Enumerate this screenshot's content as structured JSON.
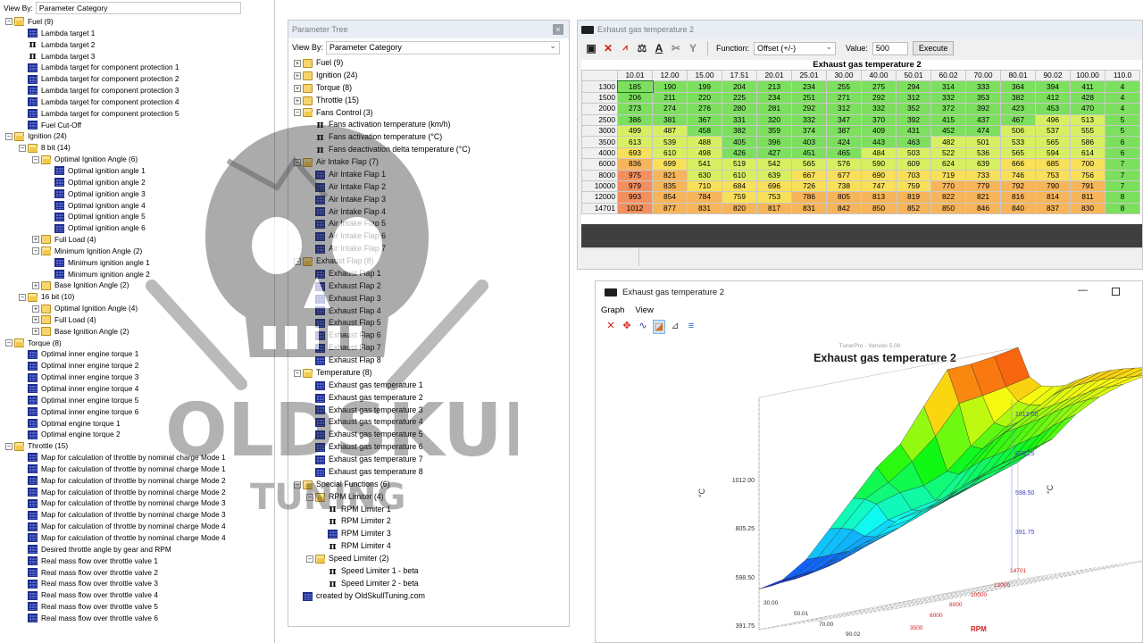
{
  "left_tree": {
    "view_by_label": "View By:",
    "view_by_value": "Parameter Category",
    "items": [
      {
        "d": 0,
        "exp": "−",
        "icon": "folder-open",
        "label": "Fuel (9)"
      },
      {
        "d": 1,
        "icon": "map",
        "label": "Lambda target 1"
      },
      {
        "d": 1,
        "icon": "pi",
        "label": "Lambda target 2"
      },
      {
        "d": 1,
        "icon": "pi",
        "label": "Lambda target 3"
      },
      {
        "d": 1,
        "icon": "map",
        "label": "Lambda target for component protection 1"
      },
      {
        "d": 1,
        "icon": "map",
        "label": "Lambda target for component protection 2"
      },
      {
        "d": 1,
        "icon": "map",
        "label": "Lambda target for component protection 3"
      },
      {
        "d": 1,
        "icon": "map",
        "label": "Lambda target for component protection 4"
      },
      {
        "d": 1,
        "icon": "map",
        "label": "Lambda target for component protection 5"
      },
      {
        "d": 1,
        "icon": "map",
        "label": "Fuel Cut-Off"
      },
      {
        "d": 0,
        "exp": "−",
        "icon": "folder-open",
        "label": "Ignition (24)"
      },
      {
        "d": 1,
        "exp": "−",
        "icon": "folder-open",
        "label": "8 bit (14)"
      },
      {
        "d": 2,
        "exp": "−",
        "icon": "folder-open",
        "label": "Optimal Ignition Angle (6)"
      },
      {
        "d": 3,
        "icon": "map",
        "label": "Optimal ignition angle 1"
      },
      {
        "d": 3,
        "icon": "map",
        "label": "Optimal ignition angle 2"
      },
      {
        "d": 3,
        "icon": "map",
        "label": "Optimal ignition angle 3"
      },
      {
        "d": 3,
        "icon": "map",
        "label": "Optimal ignition angle 4"
      },
      {
        "d": 3,
        "icon": "map",
        "label": "Optimal ignition angle 5"
      },
      {
        "d": 3,
        "icon": "map",
        "label": "Optimal ignition angle 6"
      },
      {
        "d": 2,
        "exp": "+",
        "icon": "folder",
        "label": "Full Load (4)"
      },
      {
        "d": 2,
        "exp": "−",
        "icon": "folder-open",
        "label": "Minimum Ignition Angle (2)"
      },
      {
        "d": 3,
        "icon": "map",
        "label": "Minimum ignition angle 1"
      },
      {
        "d": 3,
        "icon": "map",
        "label": "Minimum ignition angle 2"
      },
      {
        "d": 2,
        "exp": "+",
        "icon": "folder",
        "label": "Base Ignition Angle (2)"
      },
      {
        "d": 1,
        "exp": "−",
        "icon": "folder-open",
        "label": "16 bit (10)"
      },
      {
        "d": 2,
        "exp": "+",
        "icon": "folder",
        "label": "Optimal Ignition Angle (4)"
      },
      {
        "d": 2,
        "exp": "+",
        "icon": "folder",
        "label": "Full Load (4)"
      },
      {
        "d": 2,
        "exp": "+",
        "icon": "folder",
        "label": "Base Ignition Angle (2)"
      },
      {
        "d": 0,
        "exp": "−",
        "icon": "folder-open",
        "label": "Torque (8)"
      },
      {
        "d": 1,
        "icon": "map",
        "label": "Optimal inner engine torque 1"
      },
      {
        "d": 1,
        "icon": "map",
        "label": "Optimal inner engine torque 2"
      },
      {
        "d": 1,
        "icon": "map",
        "label": "Optimal inner engine torque 3"
      },
      {
        "d": 1,
        "icon": "map",
        "label": "Optimal inner engine torque 4"
      },
      {
        "d": 1,
        "icon": "map",
        "label": "Optimal inner engine torque 5"
      },
      {
        "d": 1,
        "icon": "map",
        "label": "Optimal inner engine torque 6"
      },
      {
        "d": 1,
        "icon": "map",
        "label": "Optimal engine torque 1"
      },
      {
        "d": 1,
        "icon": "map",
        "label": "Optimal engine torque 2"
      },
      {
        "d": 0,
        "exp": "−",
        "icon": "folder-open",
        "label": "Throttle (15)"
      },
      {
        "d": 1,
        "icon": "map",
        "label": "Map for calculation of throttle by nominal charge Mode 1"
      },
      {
        "d": 1,
        "icon": "map",
        "label": "Map for calculation of throttle by nominal charge Mode 1"
      },
      {
        "d": 1,
        "icon": "map",
        "label": "Map for calculation of throttle by nominal charge Mode 2"
      },
      {
        "d": 1,
        "icon": "map",
        "label": "Map for calculation of throttle by nominal charge Mode 2"
      },
      {
        "d": 1,
        "icon": "map",
        "label": "Map for calculation of throttle by nominal charge Mode 3"
      },
      {
        "d": 1,
        "icon": "map",
        "label": "Map for calculation of throttle by nominal charge Mode 3"
      },
      {
        "d": 1,
        "icon": "map",
        "label": "Map for calculation of throttle by nominal charge Mode 4"
      },
      {
        "d": 1,
        "icon": "map",
        "label": "Map for calculation of throttle by nominal charge Mode 4"
      },
      {
        "d": 1,
        "icon": "map",
        "label": "Desired throttle angle by gear and RPM"
      },
      {
        "d": 1,
        "icon": "map",
        "label": "Real mass flow over throttle valve 1"
      },
      {
        "d": 1,
        "icon": "map",
        "label": "Real mass flow over throttle valve 2"
      },
      {
        "d": 1,
        "icon": "map",
        "label": "Real mass flow over throttle valve 3"
      },
      {
        "d": 1,
        "icon": "map",
        "label": "Real mass flow over throttle valve 4"
      },
      {
        "d": 1,
        "icon": "map",
        "label": "Real mass flow over throttle valve 5"
      },
      {
        "d": 1,
        "icon": "map",
        "label": "Real mass flow over throttle valve 6"
      }
    ]
  },
  "mid_tree": {
    "title": "Parameter Tree",
    "close_glyph": "×",
    "view_by_label": "View By:",
    "view_by_value": "Parameter Category",
    "items": [
      {
        "d": 0,
        "exp": "+",
        "icon": "folder",
        "label": "Fuel (9)"
      },
      {
        "d": 0,
        "exp": "+",
        "icon": "folder",
        "label": "Ignition (24)"
      },
      {
        "d": 0,
        "exp": "+",
        "icon": "folder",
        "label": "Torque (8)"
      },
      {
        "d": 0,
        "exp": "+",
        "icon": "folder",
        "label": "Throttle (15)"
      },
      {
        "d": 0,
        "exp": "−",
        "icon": "folder-open",
        "label": "Fans Control (3)"
      },
      {
        "d": 1,
        "icon": "pi",
        "label": "Fans activation temperature (km/h)"
      },
      {
        "d": 1,
        "icon": "pi",
        "label": "Fans activation temperature (°C)"
      },
      {
        "d": 1,
        "icon": "pi",
        "label": "Fans deactivation delta temperature (°C)"
      },
      {
        "d": 0,
        "exp": "−",
        "icon": "folder-open",
        "label": "Air Intake Flap (7)"
      },
      {
        "d": 1,
        "icon": "map",
        "label": "Air Intake Flap 1"
      },
      {
        "d": 1,
        "icon": "map",
        "label": "Air Intake Flap 2"
      },
      {
        "d": 1,
        "icon": "map",
        "label": "Air Intake Flap 3"
      },
      {
        "d": 1,
        "icon": "map",
        "label": "Air Intake Flap 4"
      },
      {
        "d": 1,
        "icon": "map",
        "label": "Air Intake Flap 5"
      },
      {
        "d": 1,
        "icon": "map",
        "label": "Air Intake Flap 6"
      },
      {
        "d": 1,
        "icon": "map",
        "label": "Air Intake Flap 7"
      },
      {
        "d": 0,
        "exp": "−",
        "icon": "folder-open",
        "label": "Exhaust Flap (8)"
      },
      {
        "d": 1,
        "icon": "map",
        "label": "Exhaust Flap 1"
      },
      {
        "d": 1,
        "icon": "map",
        "label": "Exhaust Flap 2"
      },
      {
        "d": 1,
        "icon": "map",
        "label": "Exhaust Flap 3"
      },
      {
        "d": 1,
        "icon": "map",
        "label": "Exhaust Flap 4"
      },
      {
        "d": 1,
        "icon": "map",
        "label": "Exhaust Flap 5"
      },
      {
        "d": 1,
        "icon": "map",
        "label": "Exhaust Flap 6"
      },
      {
        "d": 1,
        "icon": "map",
        "label": "Exhaust Flap 7"
      },
      {
        "d": 1,
        "icon": "map",
        "label": "Exhaust Flap 8"
      },
      {
        "d": 0,
        "exp": "−",
        "icon": "folder-open",
        "label": "Temperature (8)"
      },
      {
        "d": 1,
        "icon": "map",
        "label": "Exhaust gas temperature 1"
      },
      {
        "d": 1,
        "icon": "map",
        "label": "Exhaust gas temperature 2"
      },
      {
        "d": 1,
        "icon": "map",
        "label": "Exhaust gas temperature 3"
      },
      {
        "d": 1,
        "icon": "map",
        "label": "Exhaust gas temperature 4"
      },
      {
        "d": 1,
        "icon": "map",
        "label": "Exhaust gas temperature 5"
      },
      {
        "d": 1,
        "icon": "map",
        "label": "Exhaust gas temperature 6"
      },
      {
        "d": 1,
        "icon": "map",
        "label": "Exhaust gas temperature 7"
      },
      {
        "d": 1,
        "icon": "map",
        "label": "Exhaust gas temperature 8"
      },
      {
        "d": 0,
        "exp": "−",
        "icon": "folder-open",
        "label": "Special Functions (6)"
      },
      {
        "d": 1,
        "exp": "−",
        "icon": "folder-open",
        "label": "RPM Limiter (4)"
      },
      {
        "d": 2,
        "icon": "pi",
        "label": "RPM Limiter 1"
      },
      {
        "d": 2,
        "icon": "pi",
        "label": "RPM Limiter 2"
      },
      {
        "d": 2,
        "icon": "map",
        "label": "RPM Limiter 3"
      },
      {
        "d": 2,
        "icon": "pi",
        "label": "RPM Limiter 4"
      },
      {
        "d": 1,
        "exp": "−",
        "icon": "folder-open",
        "label": "Speed Limiter (2)"
      },
      {
        "d": 2,
        "icon": "pi",
        "label": "Speed Limiter 1 - beta"
      },
      {
        "d": 2,
        "icon": "pi",
        "label": "Speed Limiter 2 - beta"
      },
      {
        "d": 0,
        "icon": "map",
        "label": "created by OldSkullTuning.com"
      }
    ]
  },
  "table_window": {
    "title": "Exhaust gas temperature 2",
    "toolbar_icons": [
      "save-icon",
      "delete-icon",
      "graph-icon",
      "balance-icon",
      "text-format-icon",
      "cut-icon",
      "merge-icon"
    ],
    "function_label": "Function:",
    "function_value": "Offset (+/-)",
    "value_label": "Value:",
    "value": "500",
    "execute_label": "Execute",
    "table_title": "Exhaust gas temperature 2",
    "columns": [
      "10.01",
      "12.00",
      "15.00",
      "17.51",
      "20.01",
      "25.01",
      "30.00",
      "40.00",
      "50.01",
      "60.02",
      "70.00",
      "80.01",
      "90.02",
      "100.00",
      "110.0"
    ],
    "rows": [
      {
        "rpm": "1300",
        "values": [
          "185",
          "190",
          "199",
          "204",
          "213",
          "234",
          "255",
          "275",
          "294",
          "314",
          "333",
          "364",
          "394",
          "411",
          "4"
        ]
      },
      {
        "rpm": "1500",
        "values": [
          "206",
          "211",
          "220",
          "225",
          "234",
          "251",
          "271",
          "292",
          "312",
          "332",
          "353",
          "382",
          "412",
          "428",
          "4"
        ]
      },
      {
        "rpm": "2000",
        "values": [
          "273",
          "274",
          "276",
          "280",
          "281",
          "292",
          "312",
          "332",
          "352",
          "372",
          "392",
          "423",
          "453",
          "470",
          "4"
        ]
      },
      {
        "rpm": "2500",
        "values": [
          "386",
          "381",
          "367",
          "331",
          "320",
          "332",
          "347",
          "370",
          "392",
          "415",
          "437",
          "467",
          "496",
          "513",
          "5"
        ]
      },
      {
        "rpm": "3000",
        "values": [
          "499",
          "487",
          "458",
          "382",
          "359",
          "374",
          "387",
          "409",
          "431",
          "452",
          "474",
          "506",
          "537",
          "555",
          "5"
        ]
      },
      {
        "rpm": "3500",
        "values": [
          "613",
          "539",
          "488",
          "405",
          "396",
          "403",
          "424",
          "443",
          "463",
          "482",
          "501",
          "533",
          "565",
          "586",
          "6"
        ]
      },
      {
        "rpm": "4000",
        "values": [
          "693",
          "610",
          "498",
          "426",
          "427",
          "451",
          "465",
          "484",
          "503",
          "522",
          "536",
          "565",
          "594",
          "614",
          "6"
        ]
      },
      {
        "rpm": "6000",
        "values": [
          "836",
          "699",
          "541",
          "519",
          "542",
          "565",
          "576",
          "590",
          "609",
          "624",
          "639",
          "666",
          "685",
          "700",
          "7"
        ]
      },
      {
        "rpm": "8000",
        "values": [
          "975",
          "821",
          "630",
          "610",
          "639",
          "667",
          "677",
          "690",
          "703",
          "719",
          "733",
          "746",
          "753",
          "756",
          "7"
        ]
      },
      {
        "rpm": "10000",
        "values": [
          "979",
          "835",
          "710",
          "684",
          "696",
          "726",
          "738",
          "747",
          "759",
          "770",
          "779",
          "792",
          "790",
          "791",
          "7"
        ]
      },
      {
        "rpm": "12000",
        "values": [
          "993",
          "854",
          "784",
          "759",
          "753",
          "786",
          "805",
          "813",
          "819",
          "822",
          "821",
          "816",
          "814",
          "811",
          "8"
        ]
      },
      {
        "rpm": "14701",
        "values": [
          "1012",
          "877",
          "831",
          "820",
          "817",
          "831",
          "842",
          "850",
          "852",
          "850",
          "846",
          "840",
          "837",
          "830",
          "8"
        ]
      }
    ]
  },
  "graph_window": {
    "title": "Exhaust gas temperature 2",
    "minimize_glyph": "—",
    "menu": [
      "Graph",
      "View"
    ],
    "tool_icons": [
      {
        "name": "close-graph-icon",
        "glyph": "✕",
        "color": "#d61b1b"
      },
      {
        "name": "rotate-icon",
        "glyph": "✥",
        "color": "#d61b1b"
      },
      {
        "name": "wave-icon",
        "glyph": "∿",
        "color": "#3a3a9a"
      },
      {
        "name": "surface-icon",
        "glyph": "◪",
        "color": "#d66b1b"
      },
      {
        "name": "grid-plane-icon",
        "glyph": "⊿",
        "color": "#444444"
      },
      {
        "name": "lines-icon",
        "glyph": "≡",
        "color": "#1b5fd6"
      }
    ]
  },
  "chart_data": {
    "type": "surface",
    "title": "Exhaust gas temperature 2",
    "subtitle": "TunerPro - Version 5.00",
    "zlabel": "°C",
    "rpm_axis_label": "RPM",
    "z_ticks": [
      "1012.00",
      "805.25",
      "598.50",
      "391.75",
      "10.01"
    ],
    "right_z_ticks": [
      "1012.00",
      "805.25",
      "598.50",
      "391.75"
    ],
    "x_ticks": [
      "30.00",
      "50.01",
      "70.00",
      "90.02"
    ],
    "rpm_ticks": [
      "14701",
      "12000",
      "10000",
      "8000",
      "6000",
      "3500"
    ],
    "colors": {
      "low": "#1f3cf0",
      "high": "#ff2400"
    }
  }
}
